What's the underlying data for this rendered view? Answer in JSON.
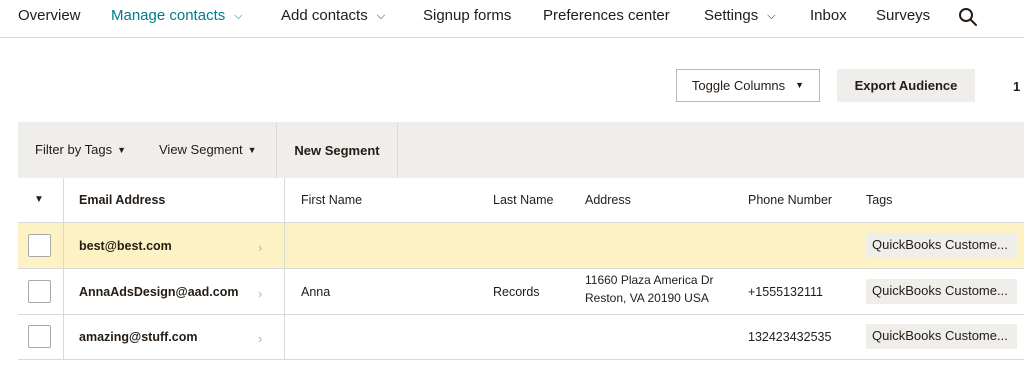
{
  "nav": {
    "items": [
      {
        "label": "Overview",
        "dropdown": false
      },
      {
        "label": "Manage contacts",
        "dropdown": true
      },
      {
        "label": "Add contacts",
        "dropdown": true
      },
      {
        "label": "Signup forms",
        "dropdown": false
      },
      {
        "label": "Preferences center",
        "dropdown": false
      },
      {
        "label": "Settings",
        "dropdown": true
      },
      {
        "label": "Inbox",
        "dropdown": false
      },
      {
        "label": "Surveys",
        "dropdown": false
      }
    ],
    "chevron": "⌄",
    "search_icon": "search-icon"
  },
  "toolbar": {
    "toggle_columns": "Toggle Columns",
    "export_audience": "Export Audience",
    "pager": "1 -"
  },
  "filters": {
    "filter_by_tags": "Filter by Tags",
    "view_segment": "View Segment",
    "new_segment": "New Segment"
  },
  "table": {
    "columns": [
      "Email Address",
      "First Name",
      "Last Name",
      "Address",
      "Phone Number",
      "Tags"
    ],
    "rows": [
      {
        "email": "best@best.com",
        "first": "",
        "last": "",
        "address_line1": "",
        "address_line2": "",
        "phone": "",
        "tag": "QuickBooks Custome...",
        "highlighted": true
      },
      {
        "email": "AnnaAdsDesign@aad.com",
        "first": "Anna",
        "last": "Records",
        "address_line1": "11660 Plaza America Dr",
        "address_line2": "Reston, VA 20190 USA",
        "phone": "+1555132111",
        "tag": "QuickBooks Custome...",
        "highlighted": false
      },
      {
        "email": "amazing@stuff.com",
        "first": "",
        "last": "",
        "address_line1": "",
        "address_line2": "",
        "phone": "132423432535",
        "tag": "QuickBooks Custome...",
        "highlighted": false
      }
    ]
  },
  "colors": {
    "accent": "#007c89",
    "highlight_row": "#fdf2c4",
    "toolbar_bg": "#efeeea"
  }
}
